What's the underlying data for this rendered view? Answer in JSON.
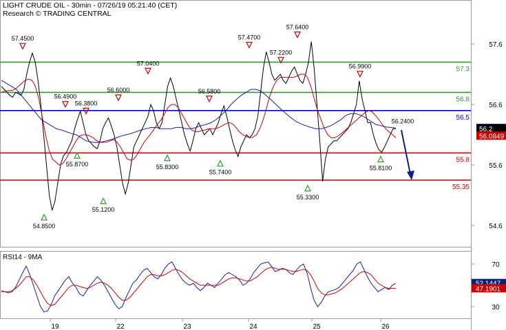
{
  "header": {
    "title": "LIGHT CRUDE OIL - 30min - 07/26/19 05:21:40 (CET)",
    "subtitle": "Research © TRADING CENTRAL"
  },
  "chart_data": [
    {
      "type": "line",
      "name": "price-panel",
      "ylim": [
        54.2,
        57.8
      ],
      "yticks": [
        "57.6",
        "56.6",
        "55.6",
        "54.6"
      ],
      "x_days": [
        "19",
        "22",
        "23",
        "24",
        "25",
        "26"
      ],
      "levels": [
        {
          "value": 57.3,
          "label": "57.3",
          "color": "#339933"
        },
        {
          "value": 56.8,
          "label": "56.8",
          "color": "#339933"
        },
        {
          "value": 56.5,
          "label": "56.5",
          "color": "#0000cc"
        },
        {
          "value": 55.8,
          "label": "55.8",
          "color": "#cc0000"
        },
        {
          "value": 55.35,
          "label": "55.35",
          "color": "#cc0000"
        }
      ],
      "last_values": [
        {
          "label": "56.2132",
          "value": 56.2132,
          "color": "#0a1f7a"
        },
        {
          "label": "56.2",
          "value": 56.2,
          "color": "#000000"
        },
        {
          "label": "56.0849",
          "value": 56.0849,
          "color": "#cc0000"
        }
      ],
      "peaks": [
        {
          "label": "57.4500",
          "value": 57.45
        },
        {
          "label": "56.4900",
          "value": 56.49
        },
        {
          "label": "56.3800",
          "value": 56.38
        },
        {
          "label": "56.6000",
          "value": 56.6
        },
        {
          "label": "57.0400",
          "value": 57.04
        },
        {
          "label": "56.5800",
          "value": 56.58
        },
        {
          "label": "57.4700",
          "value": 57.47
        },
        {
          "label": "57.2200",
          "value": 57.22
        },
        {
          "label": "57.6400",
          "value": 57.64
        },
        {
          "label": "56.9900",
          "value": 56.99
        },
        {
          "label": "56.2400",
          "value": 56.24
        }
      ],
      "troughs": [
        {
          "label": "54.8500",
          "value": 54.85
        },
        {
          "label": "55.8700",
          "value": 55.87
        },
        {
          "label": "55.1200",
          "value": 55.12
        },
        {
          "label": "55.8300",
          "value": 55.83
        },
        {
          "label": "55.7400",
          "value": 55.74
        },
        {
          "label": "55.3300",
          "value": 55.33
        },
        {
          "label": "55.8100",
          "value": 55.81
        }
      ],
      "series": [
        {
          "color": "#000000",
          "values": [
            56.9,
            56.85,
            56.8,
            56.75,
            56.72,
            56.8,
            56.78,
            56.75,
            56.85,
            57.1,
            57.3,
            57.45,
            57.3,
            57.0,
            56.6,
            56.1,
            55.6,
            55.1,
            54.85,
            55.0,
            55.3,
            55.6,
            55.75,
            55.8,
            55.9,
            56.0,
            56.2,
            56.35,
            56.49,
            56.3,
            56.1,
            56.0,
            55.95,
            55.9,
            55.87,
            56.0,
            56.2,
            56.3,
            56.38,
            56.25,
            56.1,
            55.9,
            55.6,
            55.3,
            55.12,
            55.3,
            55.6,
            55.9,
            56.0,
            56.1,
            56.2,
            56.3,
            56.4,
            56.6,
            56.5,
            56.3,
            56.2,
            56.3,
            56.6,
            56.9,
            57.04,
            56.9,
            56.7,
            56.5,
            56.3,
            56.1,
            55.95,
            55.83,
            56.0,
            56.2,
            56.3,
            56.2,
            56.1,
            56.15,
            56.2,
            56.1,
            56.2,
            56.3,
            56.45,
            56.58,
            56.4,
            56.2,
            56.0,
            55.85,
            55.74,
            55.9,
            56.0,
            56.1,
            56.05,
            56.1,
            56.2,
            56.4,
            56.8,
            57.2,
            57.47,
            57.3,
            57.1,
            57.0,
            57.05,
            57.1,
            57.0,
            56.95,
            57.05,
            57.15,
            57.22,
            57.1,
            57.0,
            56.95,
            57.1,
            57.3,
            57.64,
            57.2,
            56.6,
            56.0,
            55.33,
            55.7,
            55.9,
            55.95,
            56.0,
            56.0,
            56.05,
            56.1,
            56.15,
            56.2,
            56.3,
            56.45,
            56.6,
            56.99,
            56.7,
            56.5,
            56.3,
            56.3,
            56.1,
            55.95,
            55.85,
            55.81,
            55.9,
            56.0,
            56.1,
            56.2,
            56.2
          ]
        },
        {
          "color": "#cc0000",
          "values": [
            56.8,
            56.82,
            56.83,
            56.83,
            56.85,
            56.9,
            56.95,
            57.0,
            57.02,
            57.0,
            56.9,
            56.7,
            56.4,
            56.1,
            55.85,
            55.7,
            55.65,
            55.6,
            55.62,
            55.7,
            55.8,
            55.9,
            56.0,
            56.08,
            56.1,
            56.1,
            56.08,
            56.05,
            56.0,
            55.98,
            55.97,
            55.98,
            56.0,
            56.02,
            55.98,
            55.9,
            55.8,
            55.7,
            55.68,
            55.7,
            55.78,
            55.88,
            55.98,
            56.05,
            56.12,
            56.2,
            56.28,
            56.35,
            56.45,
            56.55,
            56.6,
            56.6,
            56.55,
            56.45,
            56.35,
            56.25,
            56.18,
            56.15,
            56.15,
            56.17,
            56.18,
            56.2,
            56.2,
            56.2,
            56.22,
            56.25,
            56.28,
            56.3,
            56.28,
            56.22,
            56.15,
            56.1,
            56.07,
            56.05,
            56.06,
            56.1,
            56.2,
            56.35,
            56.55,
            56.75,
            56.9,
            57.0,
            57.05,
            57.05,
            57.05,
            57.05,
            57.05,
            57.07,
            57.1,
            57.1,
            57.05,
            56.9,
            56.7,
            56.5,
            56.35,
            56.2,
            56.1,
            56.05,
            56.05,
            56.08,
            56.12,
            56.17,
            56.22,
            56.27,
            56.32,
            56.37,
            56.42,
            56.47,
            56.5,
            56.48,
            56.42,
            56.35,
            56.27,
            56.2,
            56.15,
            56.1,
            56.05
          ]
        },
        {
          "color": "#1a1aa0",
          "values": [
            57.0,
            56.95,
            56.9,
            56.85,
            56.75,
            56.65,
            56.55,
            56.45,
            56.35,
            56.3,
            56.25,
            56.2,
            56.18,
            56.15,
            56.12,
            56.1,
            56.05,
            56.0,
            55.98,
            55.97,
            55.98,
            56.0,
            56.02,
            56.05,
            56.08,
            56.1,
            56.12,
            56.15,
            56.18,
            56.2,
            56.22,
            56.22,
            56.2,
            56.2,
            56.2,
            56.22,
            56.22,
            56.2,
            56.2,
            56.22,
            56.25,
            56.27,
            56.3,
            56.35,
            56.42,
            56.5,
            56.6,
            56.68,
            56.75,
            56.8,
            56.85,
            56.85,
            56.82,
            56.75,
            56.68,
            56.6,
            56.52,
            56.45,
            56.38,
            56.32,
            56.28,
            56.25,
            56.22,
            56.2,
            56.2,
            56.22,
            56.25,
            56.3,
            56.35,
            56.42,
            56.45,
            56.45,
            56.42,
            56.38,
            56.32,
            56.27,
            56.25,
            56.23,
            56.22,
            56.21
          ]
        }
      ],
      "projection": {
        "from": 56.2,
        "to": 55.35,
        "color": "#0a1f7a"
      }
    },
    {
      "type": "line",
      "name": "rsi-panel",
      "title": "RSI14 - 9MA",
      "ylim": [
        20,
        80
      ],
      "yticks": [
        "70",
        "50",
        "30"
      ],
      "last_values": [
        {
          "label": "52.1447",
          "value": 52.1447,
          "color": "#0a1f7a"
        },
        {
          "label": "47.1901",
          "value": 47.2,
          "color": "#cc0000"
        }
      ],
      "series": [
        {
          "color": "#1a1aa0",
          "values": [
            45,
            44,
            43,
            44,
            48,
            55,
            62,
            68,
            60,
            50,
            40,
            30,
            25,
            26,
            32,
            40,
            45,
            50,
            55,
            58,
            52,
            48,
            42,
            40,
            45,
            50,
            54,
            58,
            55,
            50,
            44,
            38,
            32,
            28,
            30,
            38,
            45,
            52,
            55,
            60,
            64,
            66,
            62,
            58,
            56,
            60,
            66,
            70,
            72,
            66,
            60,
            55,
            52,
            50,
            52,
            48,
            45,
            48,
            52,
            50,
            48,
            52,
            56,
            60,
            62,
            60,
            58,
            55,
            50,
            52,
            56,
            62,
            66,
            70,
            71,
            72,
            68,
            63,
            64,
            66,
            65,
            62,
            60,
            64,
            68,
            70,
            62,
            48,
            36,
            30,
            34,
            40,
            44,
            45,
            46,
            48,
            52,
            56,
            60,
            64,
            70,
            72,
            65,
            58,
            52,
            48,
            44,
            46,
            48,
            46,
            50,
            52
          ]
        },
        {
          "color": "#cc0000",
          "values": [
            44,
            44,
            44,
            45,
            47,
            50,
            54,
            58,
            58,
            55,
            50,
            44,
            38,
            33,
            31,
            32,
            36,
            40,
            44,
            48,
            50,
            50,
            49,
            48,
            47,
            48,
            50,
            52,
            53,
            52,
            50,
            47,
            43,
            39,
            36,
            36,
            38,
            42,
            46,
            50,
            54,
            58,
            60,
            60,
            59,
            59,
            60,
            62,
            64,
            65,
            64,
            62,
            59,
            56,
            54,
            52,
            50,
            50,
            50,
            50,
            50,
            50,
            52,
            54,
            56,
            57,
            57,
            56,
            55,
            54,
            54,
            56,
            58,
            61,
            64,
            66,
            67,
            66,
            65,
            65,
            65,
            64,
            63,
            63,
            64,
            65,
            64,
            60,
            54,
            47,
            43,
            41,
            41,
            42,
            43,
            45,
            47,
            50,
            53,
            56,
            59,
            62,
            63,
            62,
            60,
            56,
            52,
            50,
            48,
            47,
            47,
            47
          ]
        }
      ]
    }
  ]
}
